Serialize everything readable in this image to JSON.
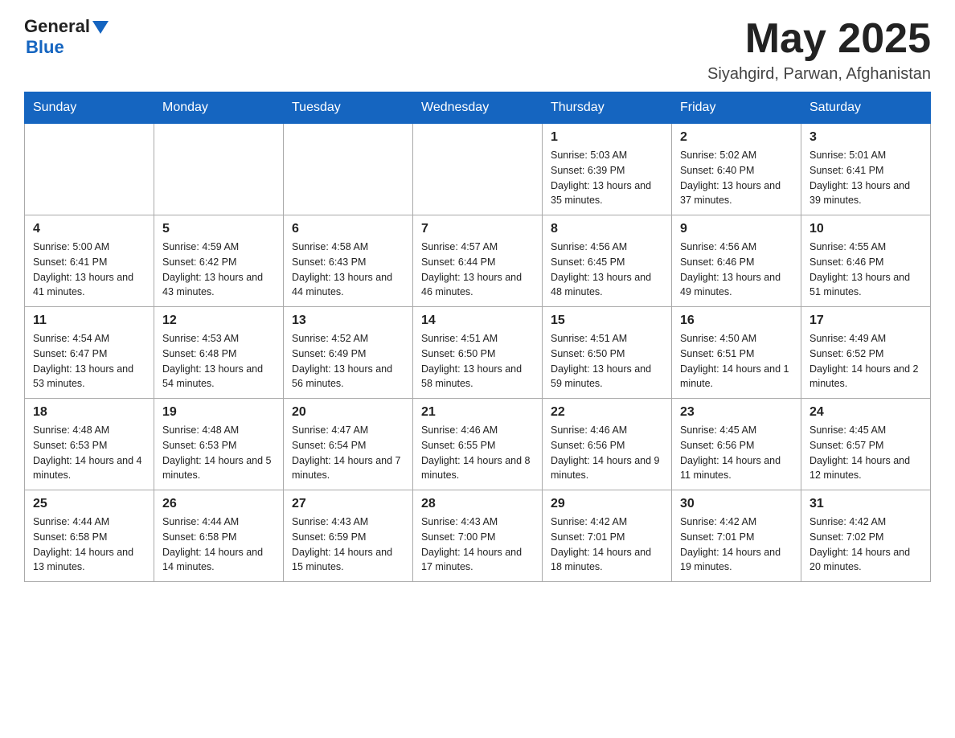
{
  "header": {
    "logo_general": "General",
    "logo_blue": "Blue",
    "month_year": "May 2025",
    "location": "Siyahgird, Parwan, Afghanistan"
  },
  "days_of_week": [
    "Sunday",
    "Monday",
    "Tuesday",
    "Wednesday",
    "Thursday",
    "Friday",
    "Saturday"
  ],
  "weeks": [
    [
      {
        "day": "",
        "info": ""
      },
      {
        "day": "",
        "info": ""
      },
      {
        "day": "",
        "info": ""
      },
      {
        "day": "",
        "info": ""
      },
      {
        "day": "1",
        "info": "Sunrise: 5:03 AM\nSunset: 6:39 PM\nDaylight: 13 hours and 35 minutes."
      },
      {
        "day": "2",
        "info": "Sunrise: 5:02 AM\nSunset: 6:40 PM\nDaylight: 13 hours and 37 minutes."
      },
      {
        "day": "3",
        "info": "Sunrise: 5:01 AM\nSunset: 6:41 PM\nDaylight: 13 hours and 39 minutes."
      }
    ],
    [
      {
        "day": "4",
        "info": "Sunrise: 5:00 AM\nSunset: 6:41 PM\nDaylight: 13 hours and 41 minutes."
      },
      {
        "day": "5",
        "info": "Sunrise: 4:59 AM\nSunset: 6:42 PM\nDaylight: 13 hours and 43 minutes."
      },
      {
        "day": "6",
        "info": "Sunrise: 4:58 AM\nSunset: 6:43 PM\nDaylight: 13 hours and 44 minutes."
      },
      {
        "day": "7",
        "info": "Sunrise: 4:57 AM\nSunset: 6:44 PM\nDaylight: 13 hours and 46 minutes."
      },
      {
        "day": "8",
        "info": "Sunrise: 4:56 AM\nSunset: 6:45 PM\nDaylight: 13 hours and 48 minutes."
      },
      {
        "day": "9",
        "info": "Sunrise: 4:56 AM\nSunset: 6:46 PM\nDaylight: 13 hours and 49 minutes."
      },
      {
        "day": "10",
        "info": "Sunrise: 4:55 AM\nSunset: 6:46 PM\nDaylight: 13 hours and 51 minutes."
      }
    ],
    [
      {
        "day": "11",
        "info": "Sunrise: 4:54 AM\nSunset: 6:47 PM\nDaylight: 13 hours and 53 minutes."
      },
      {
        "day": "12",
        "info": "Sunrise: 4:53 AM\nSunset: 6:48 PM\nDaylight: 13 hours and 54 minutes."
      },
      {
        "day": "13",
        "info": "Sunrise: 4:52 AM\nSunset: 6:49 PM\nDaylight: 13 hours and 56 minutes."
      },
      {
        "day": "14",
        "info": "Sunrise: 4:51 AM\nSunset: 6:50 PM\nDaylight: 13 hours and 58 minutes."
      },
      {
        "day": "15",
        "info": "Sunrise: 4:51 AM\nSunset: 6:50 PM\nDaylight: 13 hours and 59 minutes."
      },
      {
        "day": "16",
        "info": "Sunrise: 4:50 AM\nSunset: 6:51 PM\nDaylight: 14 hours and 1 minute."
      },
      {
        "day": "17",
        "info": "Sunrise: 4:49 AM\nSunset: 6:52 PM\nDaylight: 14 hours and 2 minutes."
      }
    ],
    [
      {
        "day": "18",
        "info": "Sunrise: 4:48 AM\nSunset: 6:53 PM\nDaylight: 14 hours and 4 minutes."
      },
      {
        "day": "19",
        "info": "Sunrise: 4:48 AM\nSunset: 6:53 PM\nDaylight: 14 hours and 5 minutes."
      },
      {
        "day": "20",
        "info": "Sunrise: 4:47 AM\nSunset: 6:54 PM\nDaylight: 14 hours and 7 minutes."
      },
      {
        "day": "21",
        "info": "Sunrise: 4:46 AM\nSunset: 6:55 PM\nDaylight: 14 hours and 8 minutes."
      },
      {
        "day": "22",
        "info": "Sunrise: 4:46 AM\nSunset: 6:56 PM\nDaylight: 14 hours and 9 minutes."
      },
      {
        "day": "23",
        "info": "Sunrise: 4:45 AM\nSunset: 6:56 PM\nDaylight: 14 hours and 11 minutes."
      },
      {
        "day": "24",
        "info": "Sunrise: 4:45 AM\nSunset: 6:57 PM\nDaylight: 14 hours and 12 minutes."
      }
    ],
    [
      {
        "day": "25",
        "info": "Sunrise: 4:44 AM\nSunset: 6:58 PM\nDaylight: 14 hours and 13 minutes."
      },
      {
        "day": "26",
        "info": "Sunrise: 4:44 AM\nSunset: 6:58 PM\nDaylight: 14 hours and 14 minutes."
      },
      {
        "day": "27",
        "info": "Sunrise: 4:43 AM\nSunset: 6:59 PM\nDaylight: 14 hours and 15 minutes."
      },
      {
        "day": "28",
        "info": "Sunrise: 4:43 AM\nSunset: 7:00 PM\nDaylight: 14 hours and 17 minutes."
      },
      {
        "day": "29",
        "info": "Sunrise: 4:42 AM\nSunset: 7:01 PM\nDaylight: 14 hours and 18 minutes."
      },
      {
        "day": "30",
        "info": "Sunrise: 4:42 AM\nSunset: 7:01 PM\nDaylight: 14 hours and 19 minutes."
      },
      {
        "day": "31",
        "info": "Sunrise: 4:42 AM\nSunset: 7:02 PM\nDaylight: 14 hours and 20 minutes."
      }
    ]
  ]
}
